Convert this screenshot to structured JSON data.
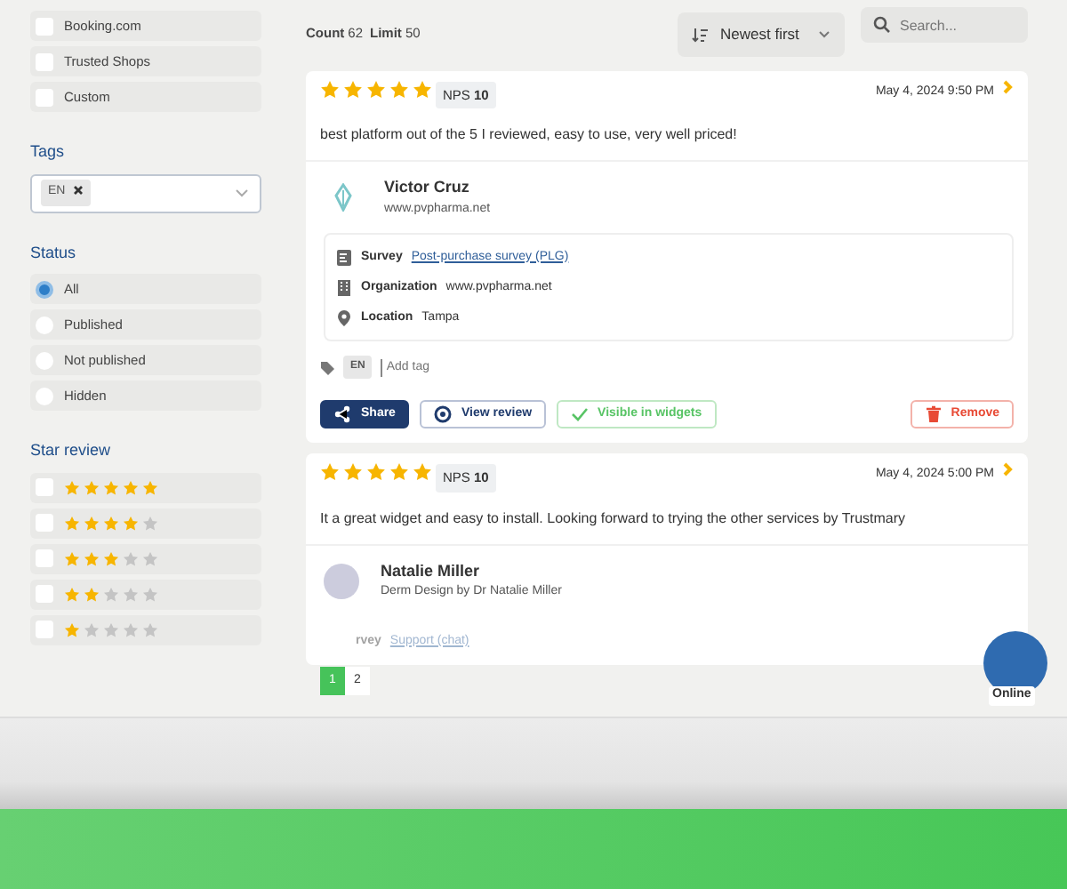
{
  "sidebar": {
    "sources": [
      {
        "label": "Booking.com",
        "checked": false
      },
      {
        "label": "Trusted Shops",
        "checked": false
      },
      {
        "label": "Custom",
        "checked": false
      }
    ],
    "tags": {
      "title": "Tags",
      "chips": [
        "EN"
      ]
    },
    "status": {
      "title": "Status",
      "options": [
        {
          "label": "All",
          "selected": true
        },
        {
          "label": "Published",
          "selected": false
        },
        {
          "label": "Not published",
          "selected": false
        },
        {
          "label": "Hidden",
          "selected": false
        }
      ]
    },
    "star_review": {
      "title": "Star review",
      "options": [
        {
          "stars": 5,
          "checked": false
        },
        {
          "stars": 4,
          "checked": false
        },
        {
          "stars": 3,
          "checked": false
        },
        {
          "stars": 2,
          "checked": false
        },
        {
          "stars": 1,
          "checked": false
        }
      ]
    }
  },
  "toolbar": {
    "count_label": "Count",
    "count": "62",
    "limit_label": "Limit",
    "limit": "50",
    "sort": "Newest first",
    "search_placeholder": "Search..."
  },
  "reviews": [
    {
      "stars": 5,
      "nps_label": "NPS",
      "nps": "10",
      "date": "May 4, 2024 9:50 PM",
      "text": "best platform out of the 5 I reviewed, easy to use, very well priced!",
      "author": {
        "name": "Victor Cruz",
        "subtitle": "www.pvpharma.net",
        "kind": "logo"
      },
      "details": [
        {
          "label": "Survey",
          "value": "Post-purchase survey (PLG)",
          "kind": "link"
        },
        {
          "label": "Organization",
          "value": "www.pvpharma.net",
          "kind": "text"
        },
        {
          "label": "Location",
          "value": "Tampa",
          "kind": "text"
        }
      ],
      "tags": [
        "EN"
      ],
      "tag_placeholder": "Add tag",
      "actions": [
        {
          "label": "Share",
          "kind": "share"
        },
        {
          "label": "View review",
          "kind": "view"
        },
        {
          "label": "Visible in widgets",
          "kind": "visible"
        },
        {
          "label": "Remove",
          "kind": "remove"
        }
      ]
    },
    {
      "stars": 5,
      "nps_label": "NPS",
      "nps": "10",
      "date": "May 4, 2024 5:00 PM",
      "text": "It a great widget and easy to install. Looking forward to trying the other services by Trustmary",
      "author": {
        "name": "Natalie Miller",
        "subtitle": "Derm Design by Dr Natalie Miller",
        "kind": "photo"
      },
      "details": [
        {
          "label": "rvey",
          "value": "Support (chat)",
          "kind": "link"
        }
      ]
    }
  ],
  "pagination": [
    {
      "label": "1",
      "selected": true
    },
    {
      "label": "2",
      "selected": false
    }
  ],
  "chat": {
    "status": "Online"
  }
}
